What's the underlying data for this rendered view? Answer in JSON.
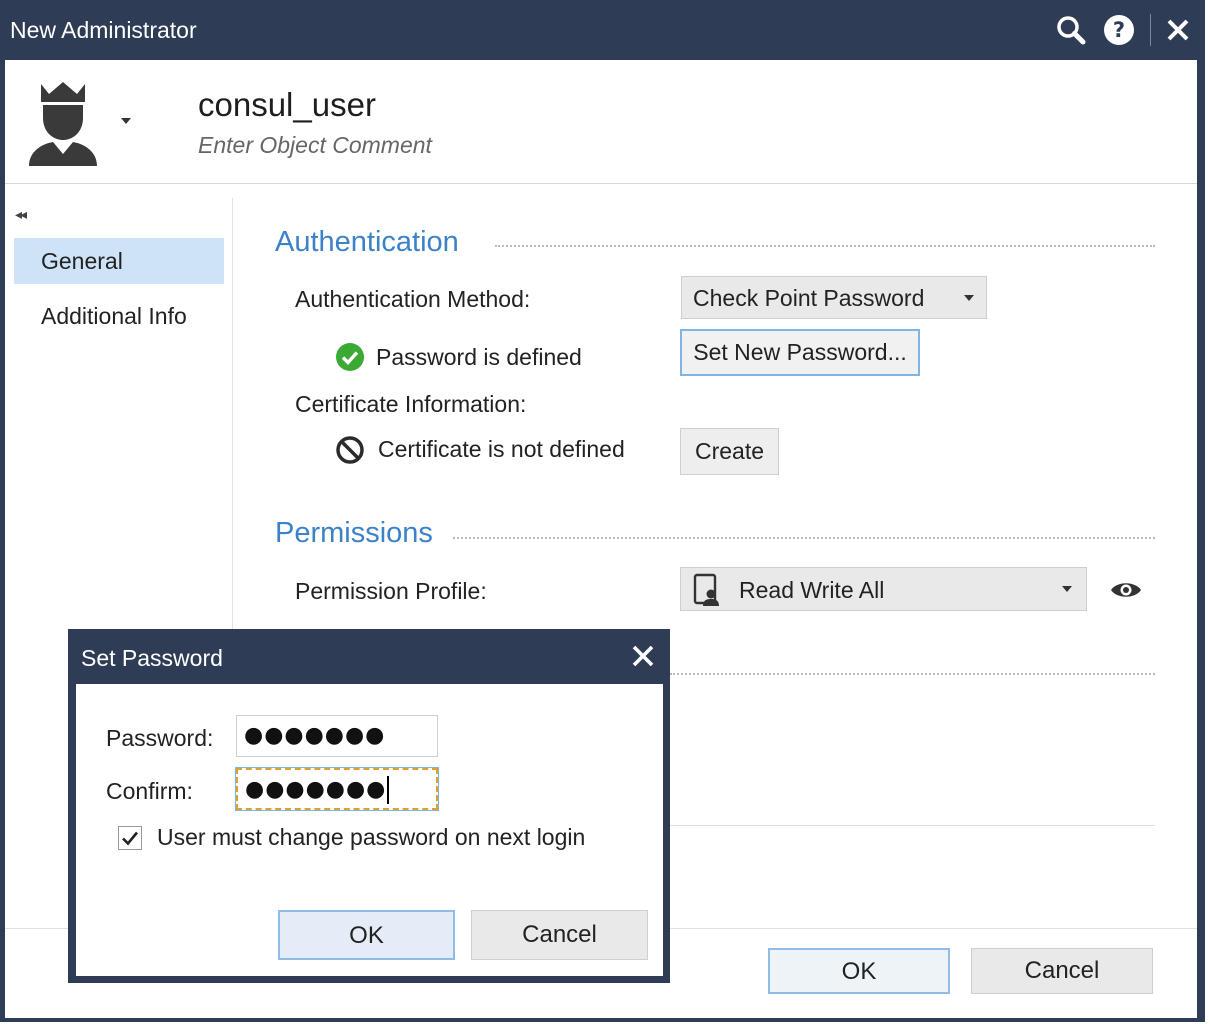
{
  "window": {
    "title": "New Administrator"
  },
  "header": {
    "object_name": "consul_user",
    "object_comment_placeholder": "Enter Object Comment",
    "icon": "admin-crown-icon"
  },
  "nav": {
    "collapse_icon": "double-chevron-left-icon",
    "items": [
      {
        "label": "General",
        "active": true
      },
      {
        "label": "Additional Info",
        "active": false
      }
    ]
  },
  "authentication": {
    "section_title": "Authentication",
    "method_label": "Authentication Method:",
    "method_value": "Check Point Password",
    "password_status": "Password is defined",
    "set_password_button": "Set New Password...",
    "certificate_label": "Certificate Information:",
    "certificate_status": "Certificate is not defined",
    "create_button": "Create"
  },
  "permissions": {
    "section_title": "Permissions",
    "profile_label": "Permission Profile:",
    "profile_value": "Read Write All"
  },
  "footer": {
    "ok_label": "OK",
    "cancel_label": "Cancel"
  },
  "dialog": {
    "title": "Set Password",
    "password_label": "Password:",
    "password_value": "●●●●●●●",
    "confirm_label": "Confirm:",
    "confirm_value": "●●●●●●●",
    "must_change_label": "User must change password on next login",
    "must_change_checked": true,
    "ok_label": "OK",
    "cancel_label": "Cancel"
  },
  "colors": {
    "titlebar": "#2e3d55",
    "accent": "#3c82c8",
    "nav_active": "#cfe3f8",
    "success": "#3aaa35"
  }
}
